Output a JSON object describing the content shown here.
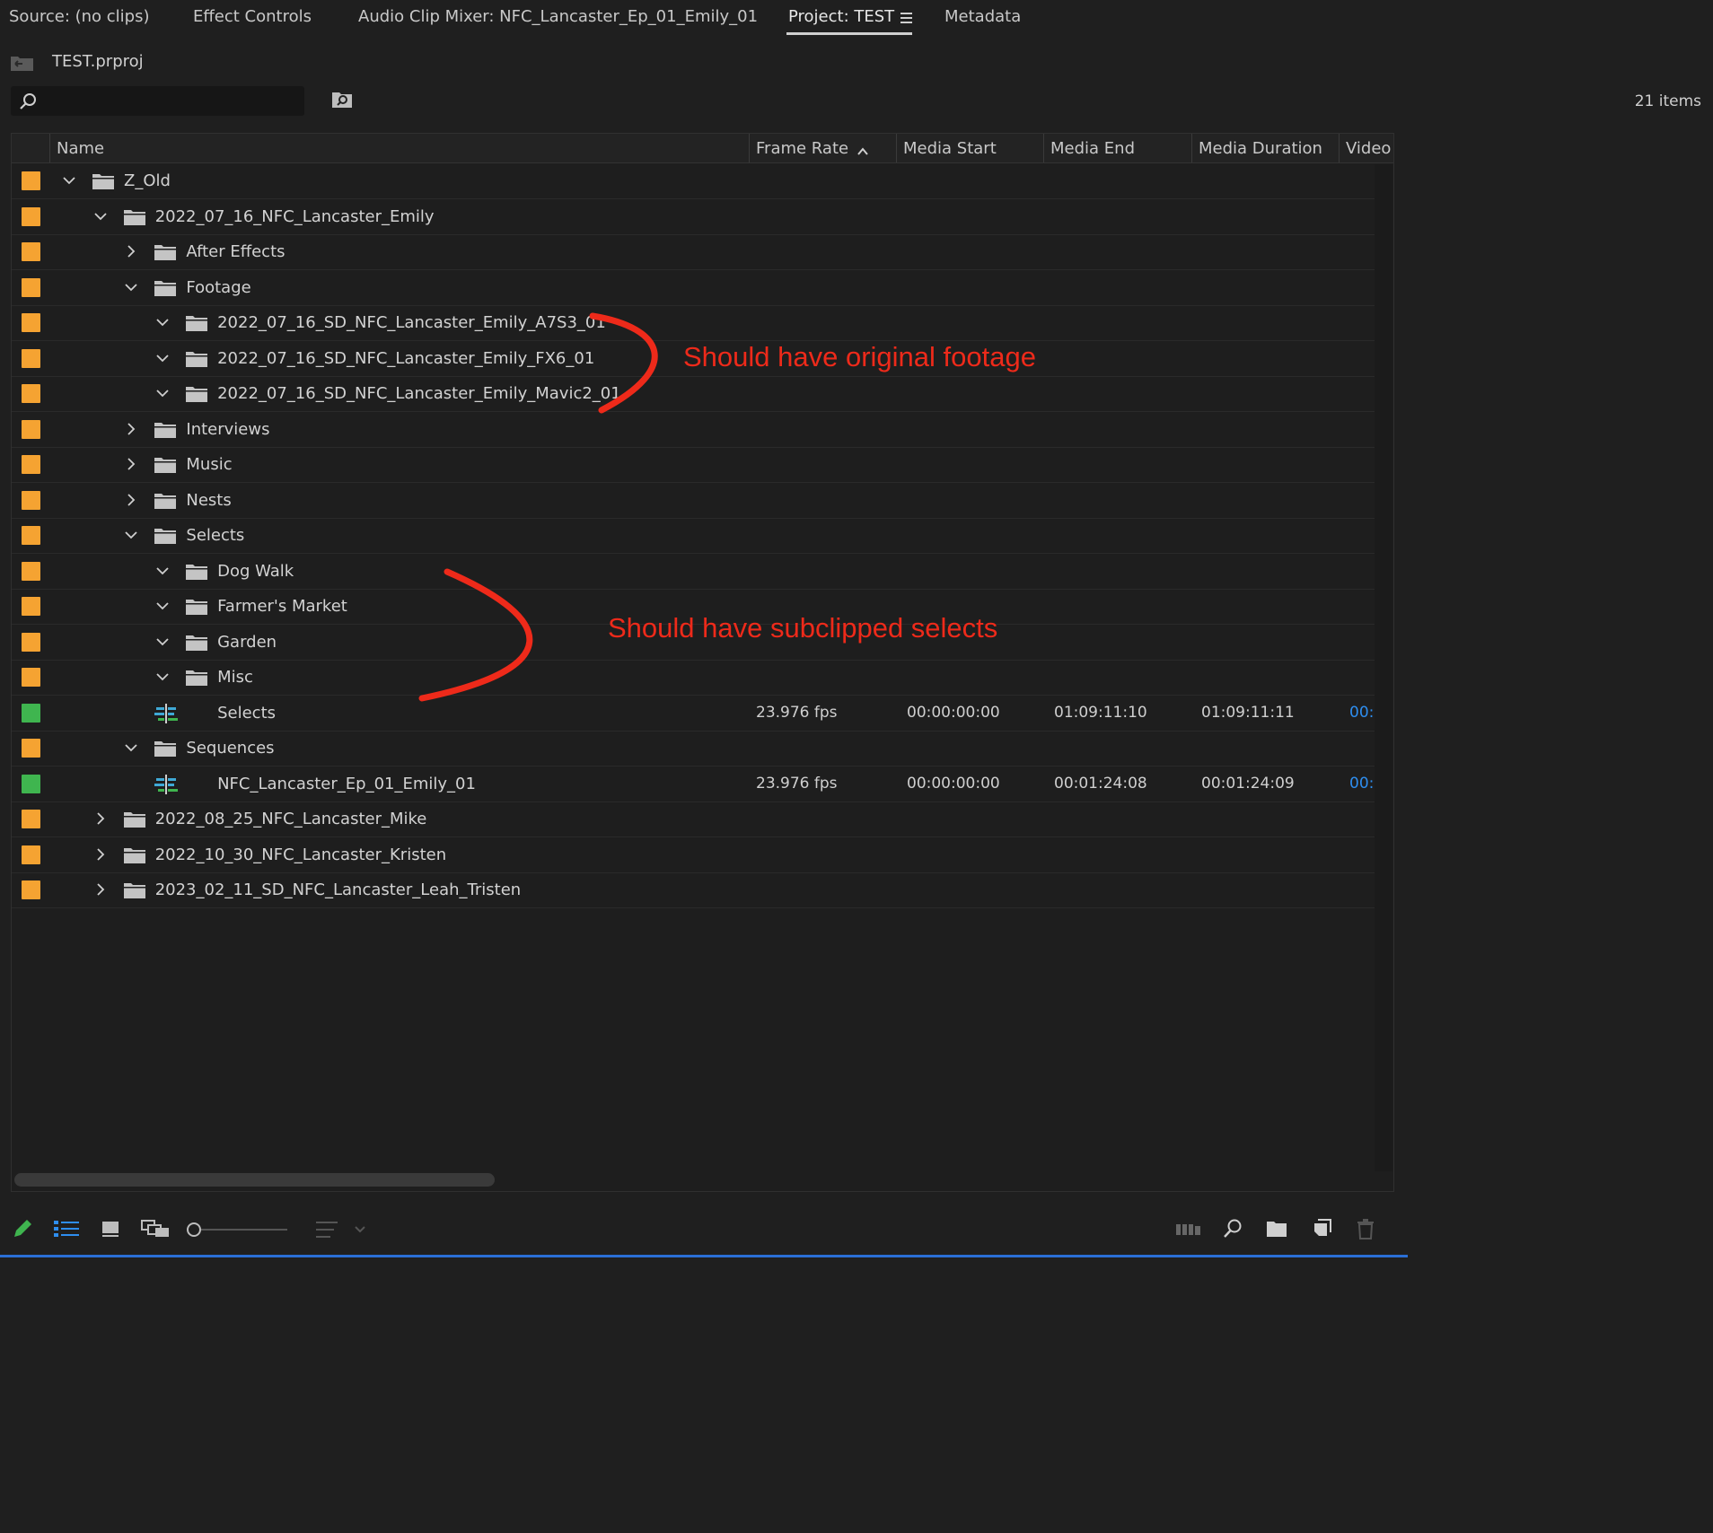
{
  "tabs": [
    {
      "label": "Source: (no clips)"
    },
    {
      "label": "Effect Controls"
    },
    {
      "label": "Audio Clip Mixer: NFC_Lancaster_Ep_01_Emily_01"
    },
    {
      "label": "Project: TEST"
    },
    {
      "label": "Metadata"
    }
  ],
  "active_tab": "Project: TEST",
  "project_file": "TEST.prproj",
  "search": {
    "value": "",
    "placeholder": ""
  },
  "items_count": "21 items",
  "columns": [
    "Name",
    "Frame Rate",
    "Media Start",
    "Media End",
    "Media Duration",
    "Video"
  ],
  "sort_column": "Frame Rate",
  "rows": [
    {
      "name": "Z_Old",
      "type": "bin",
      "expanded": true,
      "label_color": "#f5a332",
      "frame_rate": "",
      "media_start": "",
      "media_end": "",
      "media_duration": "",
      "video": ""
    },
    {
      "name": "2022_07_16_NFC_Lancaster_Emily",
      "type": "bin",
      "expanded": true,
      "label_color": "#f5a332",
      "frame_rate": "",
      "media_start": "",
      "media_end": "",
      "media_duration": "",
      "video": ""
    },
    {
      "name": "After Effects",
      "type": "bin",
      "expanded": false,
      "label_color": "#f5a332",
      "frame_rate": "",
      "media_start": "",
      "media_end": "",
      "media_duration": "",
      "video": ""
    },
    {
      "name": "Footage",
      "type": "bin",
      "expanded": true,
      "label_color": "#f5a332",
      "frame_rate": "",
      "media_start": "",
      "media_end": "",
      "media_duration": "",
      "video": ""
    },
    {
      "name": "2022_07_16_SD_NFC_Lancaster_Emily_A7S3_01",
      "type": "bin",
      "expanded": true,
      "label_color": "#f5a332",
      "frame_rate": "",
      "media_start": "",
      "media_end": "",
      "media_duration": "",
      "video": ""
    },
    {
      "name": "2022_07_16_SD_NFC_Lancaster_Emily_FX6_01",
      "type": "bin",
      "expanded": true,
      "label_color": "#f5a332",
      "frame_rate": "",
      "media_start": "",
      "media_end": "",
      "media_duration": "",
      "video": ""
    },
    {
      "name": "2022_07_16_SD_NFC_Lancaster_Emily_Mavic2_01",
      "type": "bin",
      "expanded": true,
      "label_color": "#f5a332",
      "frame_rate": "",
      "media_start": "",
      "media_end": "",
      "media_duration": "",
      "video": ""
    },
    {
      "name": "Interviews",
      "type": "bin",
      "expanded": false,
      "label_color": "#f5a332",
      "frame_rate": "",
      "media_start": "",
      "media_end": "",
      "media_duration": "",
      "video": ""
    },
    {
      "name": "Music",
      "type": "bin",
      "expanded": false,
      "label_color": "#f5a332",
      "frame_rate": "",
      "media_start": "",
      "media_end": "",
      "media_duration": "",
      "video": ""
    },
    {
      "name": "Nests",
      "type": "bin",
      "expanded": false,
      "label_color": "#f5a332",
      "frame_rate": "",
      "media_start": "",
      "media_end": "",
      "media_duration": "",
      "video": ""
    },
    {
      "name": "Selects",
      "type": "bin",
      "expanded": true,
      "label_color": "#f5a332",
      "frame_rate": "",
      "media_start": "",
      "media_end": "",
      "media_duration": "",
      "video": ""
    },
    {
      "name": "Dog Walk",
      "type": "bin",
      "expanded": true,
      "label_color": "#f5a332",
      "frame_rate": "",
      "media_start": "",
      "media_end": "",
      "media_duration": "",
      "video": ""
    },
    {
      "name": "Farmer's Market",
      "type": "bin",
      "expanded": true,
      "label_color": "#f5a332",
      "frame_rate": "",
      "media_start": "",
      "media_end": "",
      "media_duration": "",
      "video": ""
    },
    {
      "name": "Garden",
      "type": "bin",
      "expanded": true,
      "label_color": "#f5a332",
      "frame_rate": "",
      "media_start": "",
      "media_end": "",
      "media_duration": "",
      "video": ""
    },
    {
      "name": "Misc",
      "type": "bin",
      "expanded": true,
      "label_color": "#f5a332",
      "frame_rate": "",
      "media_start": "",
      "media_end": "",
      "media_duration": "",
      "video": ""
    },
    {
      "name": "Selects",
      "type": "sequence",
      "expanded": false,
      "label_color": "#3fb54f",
      "frame_rate": "23.976 fps",
      "media_start": "00:00:00:00",
      "media_end": "01:09:11:10",
      "media_duration": "01:09:11:11",
      "video": "00:("
    },
    {
      "name": "Sequences",
      "type": "bin",
      "expanded": true,
      "label_color": "#f5a332",
      "frame_rate": "",
      "media_start": "",
      "media_end": "",
      "media_duration": "",
      "video": ""
    },
    {
      "name": "NFC_Lancaster_Ep_01_Emily_01",
      "type": "sequence",
      "expanded": false,
      "label_color": "#3fb54f",
      "frame_rate": "23.976 fps",
      "media_start": "00:00:00:00",
      "media_end": "00:01:24:08",
      "media_duration": "00:01:24:09",
      "video": "00:("
    },
    {
      "name": "2022_08_25_NFC_Lancaster_Mike",
      "type": "bin",
      "expanded": false,
      "label_color": "#f5a332",
      "frame_rate": "",
      "media_start": "",
      "media_end": "",
      "media_duration": "",
      "video": ""
    },
    {
      "name": "2022_10_30_NFC_Lancaster_Kristen",
      "type": "bin",
      "expanded": false,
      "label_color": "#f5a332",
      "frame_rate": "",
      "media_start": "",
      "media_end": "",
      "media_duration": "",
      "video": ""
    },
    {
      "name": "2023_02_11_SD_NFC_Lancaster_Leah_Tristen",
      "type": "bin",
      "expanded": false,
      "label_color": "#f5a332",
      "frame_rate": "",
      "media_start": "",
      "media_end": "",
      "media_duration": "",
      "video": ""
    }
  ],
  "annotations": [
    {
      "text": "Should have original footage",
      "color": "#ee2a1a"
    },
    {
      "text": "Should have subclipped selects",
      "color": "#ee2a1a"
    }
  ],
  "bottom_toolbar": [
    "pencil-icon",
    "list-view-icon",
    "icon-view-icon",
    "freeform-view-icon",
    "zoom-slider",
    "sort-icons-icon",
    "automate-to-sequence-icon",
    "find-icon",
    "new-bin-icon",
    "new-item-icon",
    "trash-icon"
  ]
}
